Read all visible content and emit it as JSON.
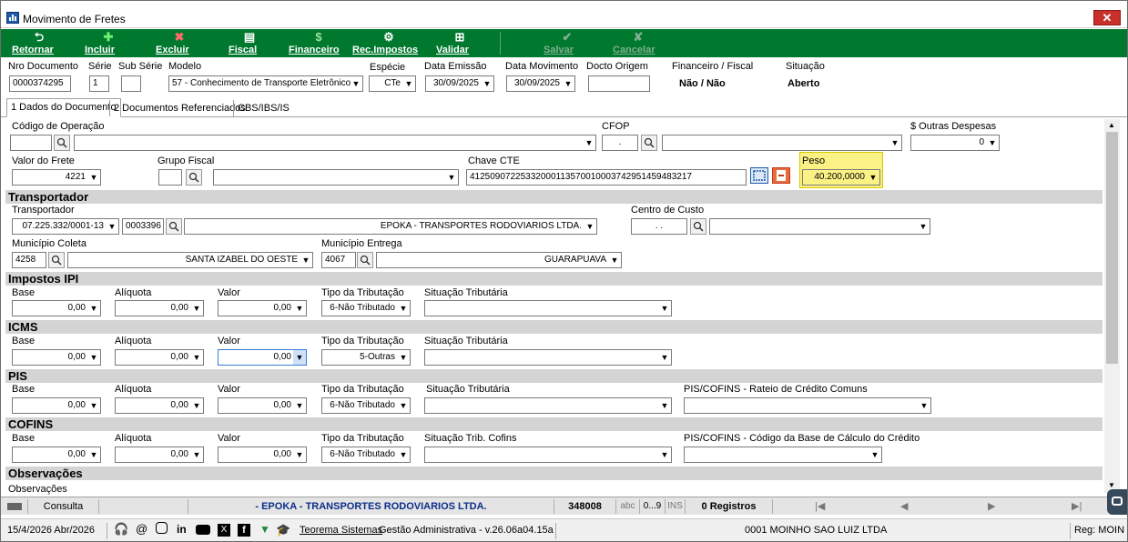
{
  "window": {
    "title": "Movimento de Fretes",
    "close_label": "✕"
  },
  "toolbar": [
    {
      "label": "Retornar",
      "icon": "return-icon",
      "glyph": "⮌",
      "enabled": true
    },
    {
      "label": "Incluir",
      "icon": "plus-icon",
      "glyph": "✚",
      "enabled": true
    },
    {
      "label": "Excluir",
      "icon": "delete-icon",
      "glyph": "✖",
      "enabled": true
    },
    {
      "label": "Fiscal",
      "icon": "document-icon",
      "glyph": "▤",
      "enabled": true
    },
    {
      "label": "Financeiro",
      "icon": "money-icon",
      "glyph": "$",
      "enabled": true
    },
    {
      "label": "Rec.Impostos",
      "icon": "gear-icon",
      "glyph": "⚙",
      "enabled": true
    },
    {
      "label": "Validar",
      "icon": "grid-icon",
      "glyph": "⊞",
      "enabled": true
    },
    {
      "label": "Salvar",
      "icon": "check-icon",
      "glyph": "✔",
      "enabled": false
    },
    {
      "label": "Cancelar",
      "icon": "cancel-icon",
      "glyph": "✘",
      "enabled": false
    }
  ],
  "header": {
    "nro_documento": {
      "label": "Nro Documento",
      "value": "0000374295"
    },
    "serie": {
      "label": "Série",
      "value": "1"
    },
    "sub_serie": {
      "label": "Sub Série",
      "value": ""
    },
    "modelo": {
      "label": "Modelo",
      "value": "57 - Conhecimento de Transporte Eletrônico"
    },
    "especie": {
      "label": "Espécie",
      "value": "CTe"
    },
    "data_emissao": {
      "label": "Data Emissão",
      "value": "30/09/2025"
    },
    "data_movimento": {
      "label": "Data Movimento",
      "value": "30/09/2025"
    },
    "docto_origem": {
      "label": "Docto Origem",
      "value": ""
    },
    "financeiro_fiscal": {
      "label": "Financeiro / Fiscal",
      "value": "Não / Não"
    },
    "situacao": {
      "label": "Situação",
      "value": "Aberto"
    }
  },
  "tabs": [
    {
      "label": "1 Dados do Documento",
      "active": true
    },
    {
      "label": "2 Documentos Referenciados",
      "active": false
    },
    {
      "label": "CBS/IBS/IS",
      "active": false
    }
  ],
  "form": {
    "codigo_operacao_label": "Código de Operação",
    "cfop_label": "CFOP",
    "cfop_value": ".",
    "outras_despesas_label": "$ Outras Despesas",
    "outras_despesas_value": "0",
    "valor_frete_label": "Valor do Frete",
    "valor_frete_value": "4221",
    "grupo_fiscal_label": "Grupo Fiscal",
    "chave_cte_label": "Chave CTE",
    "chave_cte_value": "41250907225332000113570010003742951459483217",
    "peso_label": "Peso",
    "peso_value": "40.200,0000"
  },
  "transportador": {
    "section": "Transportador",
    "label": "Transportador",
    "cnpj": "07.225.332/0001-13",
    "code": "0003396",
    "name": "EPOKA - TRANSPORTES RODOVIARIOS LTDA.",
    "centro_custo_label": "Centro de Custo",
    "centro_custo_value": ". .",
    "mun_coleta_label": "Município Coleta",
    "mun_coleta_code": "4258",
    "mun_coleta_name": "SANTA IZABEL DO OESTE",
    "mun_entrega_label": "Município Entrega",
    "mun_entrega_code": "4067",
    "mun_entrega_name": "GUARAPUAVA"
  },
  "taxes": {
    "ipi": {
      "section": "Impostos IPI",
      "base": "0,00",
      "aliquota": "0,00",
      "valor": "0,00",
      "tipo": "6-Não Tributado",
      "situacao_label": "Situação Tributária"
    },
    "icms": {
      "section": "ICMS",
      "base": "0,00",
      "aliquota": "0,00",
      "valor": "0,00",
      "tipo": "5-Outras",
      "situacao_label": "Situação Tributária"
    },
    "pis": {
      "section": "PIS",
      "base": "0,00",
      "aliquota": "0,00",
      "valor": "0,00",
      "tipo": "6-Não Tributado",
      "situacao_label": "Situação Tributária",
      "extra_label": "PIS/COFINS - Rateio de Crédito Comuns"
    },
    "cofins": {
      "section": "COFINS",
      "base": "0,00",
      "aliquota": "0,00",
      "valor": "0,00",
      "tipo": "6-Não Tributado",
      "situacao_label": "Situação Trib. Cofins",
      "extra_label": "PIS/COFINS - Código da Base de Cálculo do Crédito"
    },
    "labels": {
      "base": "Base",
      "aliquota": "Alíquota",
      "valor": "Valor",
      "tipo": "Tipo da Tributação"
    }
  },
  "observacoes": {
    "section": "Observações",
    "label": "Observações"
  },
  "statusbar": {
    "mode": "Consulta",
    "company": "- EPOKA - TRANSPORTES RODOVIARIOS LTDA.",
    "code": "348008",
    "abc": "abc",
    "num": "0...9",
    "ins": "INS",
    "registros": "0 Registros"
  },
  "footer": {
    "date": "15/4/2026 Abr/2026",
    "brand": "Teorema Sistemas",
    "app": "Gestão Administrativa - v.26.06a04.15a",
    "company": "0001 MOINHO SAO LUIZ LTDA",
    "reg": "Reg: MOIN"
  }
}
